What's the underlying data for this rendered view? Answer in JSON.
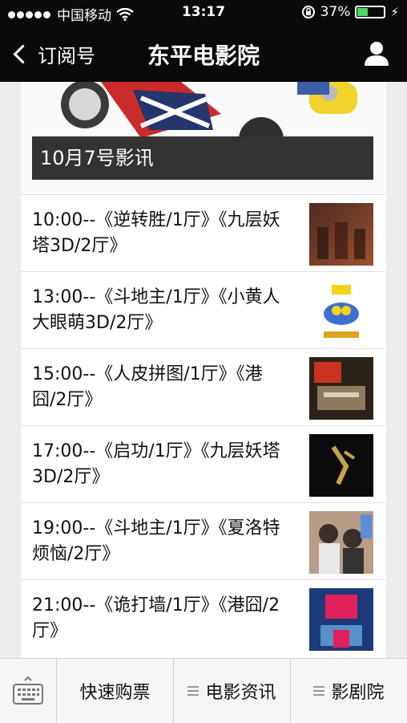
{
  "status": {
    "carrier": "中国移动",
    "time": "13:17",
    "battery": "37%",
    "battery_level": 0.37
  },
  "nav": {
    "back_label": "订阅号",
    "title": "东平电影院"
  },
  "hero": {
    "title": "10月7号影讯"
  },
  "showtimes": [
    {
      "text": "10:00--《逆转胜/1厅》《九层妖塔3D/2厅》",
      "thumb_colors": [
        "#4a2a22",
        "#a0522d"
      ]
    },
    {
      "text": "13:00--《斗地主/1厅》《小黄人大眼萌3D/2厅》",
      "thumb_colors": [
        "#f6d21b",
        "#3b6fd1"
      ]
    },
    {
      "text": "15:00--《人皮拼图/1厅》《港囧/2厅》",
      "thumb_colors": [
        "#2a2218",
        "#c8341f"
      ]
    },
    {
      "text": "17:00--《启功/1厅》《九层妖塔3D/2厅》",
      "thumb_colors": [
        "#0b0b0b",
        "#c9a24a"
      ]
    },
    {
      "text": "19:00--《斗地主/1厅》《夏洛特烦恼/2厅》",
      "thumb_colors": [
        "#b89d86",
        "#3a2f2a"
      ]
    },
    {
      "text": "21:00--《诡打墙/1厅》《港囧/2厅》",
      "thumb_colors": [
        "#1d3b7a",
        "#e2215b"
      ]
    }
  ],
  "tabbar": {
    "tab1": "快速购票",
    "tab2": "电影资讯",
    "tab3": "影剧院"
  }
}
